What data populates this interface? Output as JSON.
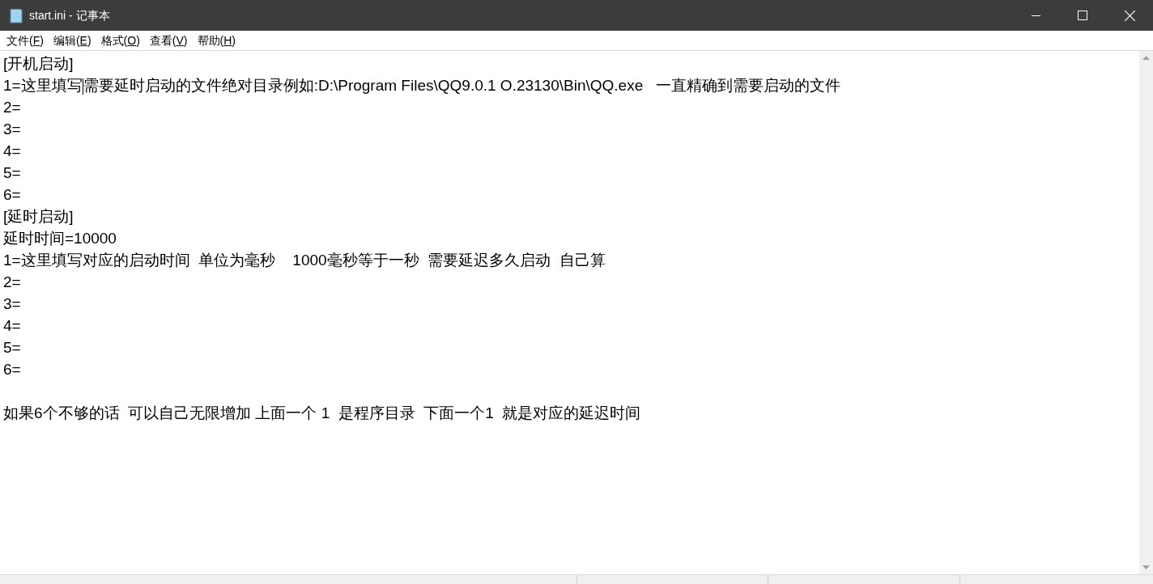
{
  "window": {
    "title": "start.ini - 记事本"
  },
  "menu": [
    {
      "text": "文件(",
      "key": "F",
      "tail": ")"
    },
    {
      "text": "编辑(",
      "key": "E",
      "tail": ")"
    },
    {
      "text": "格式(",
      "key": "O",
      "tail": ")"
    },
    {
      "text": "查看(",
      "key": "V",
      "tail": ")"
    },
    {
      "text": "帮助(",
      "key": "H",
      "tail": ")"
    }
  ],
  "editor": {
    "lines": [
      {
        "kind": "text",
        "text": "[开机启动]"
      },
      {
        "kind": "caret",
        "before": "1=这里填写",
        "after": "需要延时启动的文件绝对目录例如:D:\\Program Files\\QQ9.0.1 O.23130\\Bin\\QQ.exe   一直精确到需要启动的文件"
      },
      {
        "kind": "text",
        "text": "2="
      },
      {
        "kind": "text",
        "text": "3="
      },
      {
        "kind": "text",
        "text": "4="
      },
      {
        "kind": "text",
        "text": "5="
      },
      {
        "kind": "text",
        "text": "6="
      },
      {
        "kind": "text",
        "text": "[延时启动]"
      },
      {
        "kind": "text",
        "text": "延时时间=10000"
      },
      {
        "kind": "text",
        "text": "1=这里填写对应的启动时间  单位为毫秒    1000毫秒等于一秒  需要延迟多久启动  自己算"
      },
      {
        "kind": "text",
        "text": "2="
      },
      {
        "kind": "text",
        "text": "3="
      },
      {
        "kind": "text",
        "text": "4="
      },
      {
        "kind": "text",
        "text": "5="
      },
      {
        "kind": "text",
        "text": "6="
      },
      {
        "kind": "blank"
      },
      {
        "kind": "text",
        "text": "如果6个不够的话  可以自己无限增加 上面一个 1  是程序目录  下面一个1  就是对应的延迟时间"
      }
    ]
  }
}
